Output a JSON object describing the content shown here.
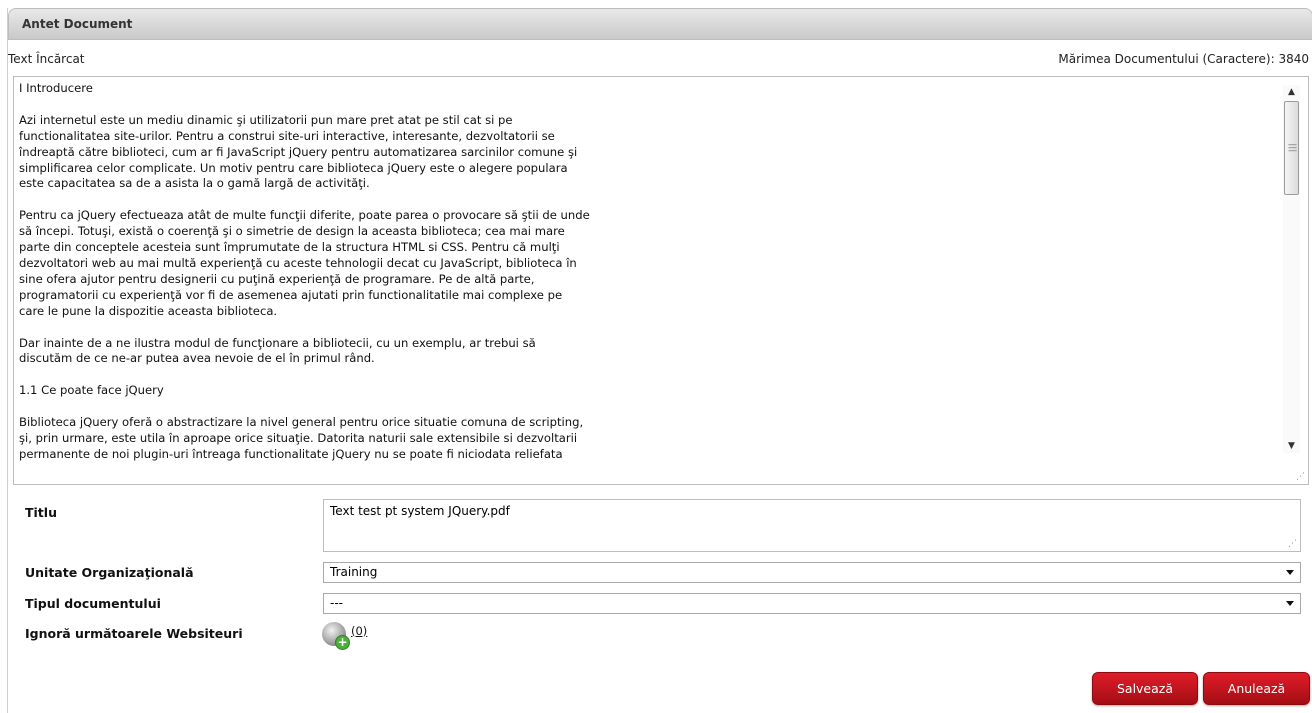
{
  "panel": {
    "title": "Antet Document"
  },
  "info": {
    "loaded_label": "Text Încărcat",
    "size_label": "Mărimea Documentului (Caractere): 3840"
  },
  "document": {
    "text": "I Introducere\n\nAzi internetul este un mediu dinamic şi utilizatorii pun mare pret atat pe stil cat si pe\nfunctionalitatea site-urilor. Pentru a construi site-uri interactive, interesante, dezvoltatorii se\nîndreaptă către biblioteci, cum ar fi JavaScript jQuery pentru automatizarea sarcinilor comune şi\nsimplificarea celor complicate. Un motiv pentru care biblioteca jQuery este o alegere populara\neste capacitatea sa de a asista la o gamă largă de activităţi.\n\nPentru ca jQuery efectueaza atât de multe funcţii diferite, poate parea o provocare să ştii de unde\nsă începi. Totuşi, există o coerenţă şi o simetrie de design la aceasta biblioteca; cea mai mare\nparte din conceptele acesteia sunt împrumutate de la structura HTML si CSS. Pentru că mulţi\ndezvoltatori web au mai multă experienţă cu aceste tehnologii decat cu JavaScript, biblioteca în\nsine ofera ajutor pentru designerii cu puţină experienţă de programare. Pe de altă parte,\nprogramatorii cu experienţă vor fi de asemenea ajutati prin functionalitatile mai complexe pe\ncare le pune la dispozitie aceasta biblioteca.\n\nDar inainte de a ne ilustra modul de funcţionare a bibliotecii, cu un exemplu, ar trebui să\ndiscutăm de ce ne-ar putea avea nevoie de el în primul rând.\n\n1.1 Ce poate face jQuery\n\nBiblioteca jQuery oferă o abstractizare la nivel general pentru orice situatie comuna de scripting,\nşi, prin urmare, este utila în aproape orice situaţie. Datorita naturii sale extensibile si dezvoltarii\npermanente de noi plugin-uri întreaga functionalitate jQuery nu se poate fi niciodata reliefata"
  },
  "form": {
    "title_label": "Titlu",
    "title_value": "Text test pt system JQuery.pdf",
    "org_label": "Unitate Organizaţională",
    "org_value": "Training",
    "doctype_label": "Tipul documentului",
    "doctype_value": "---",
    "ignore_label": "Ignoră următoarele Websiteuri",
    "ignore_count": "(0)"
  },
  "buttons": {
    "save": "Salvează",
    "cancel": "Anulează"
  },
  "icons": {
    "ignore": "website-add-icon"
  },
  "colors": {
    "button_red": "#d01822",
    "header_gray": "#d4d4d4"
  }
}
